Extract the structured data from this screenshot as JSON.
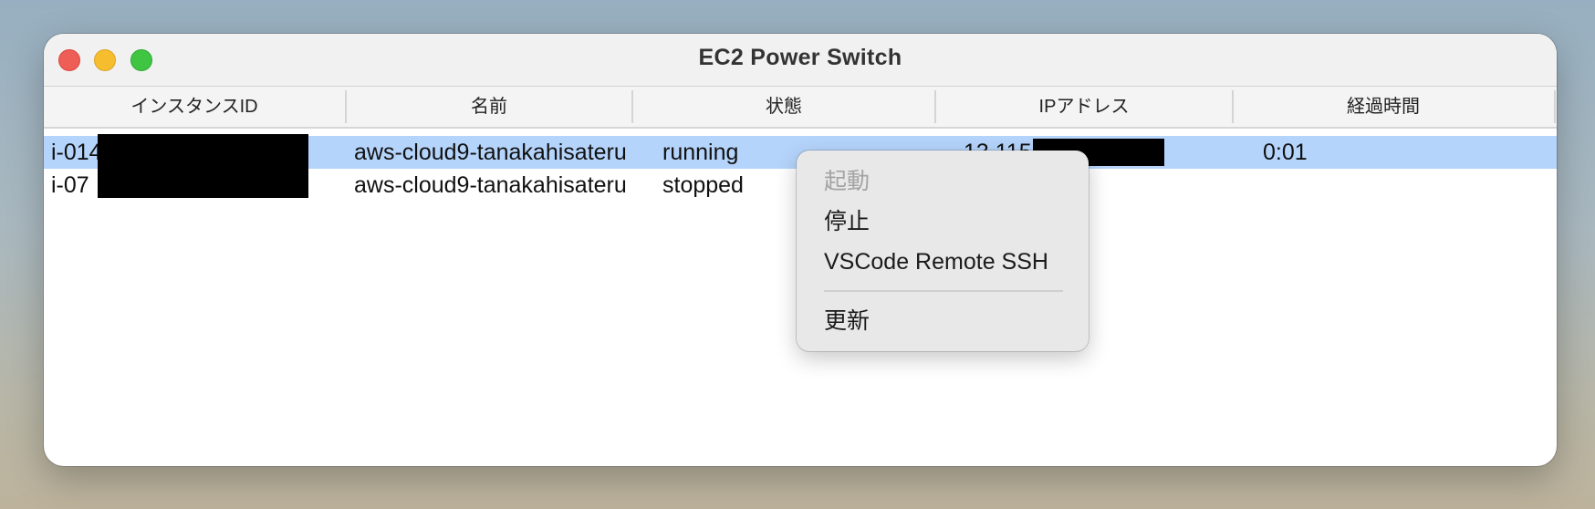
{
  "window": {
    "title": "EC2 Power Switch"
  },
  "table": {
    "columns": [
      "インスタンスID",
      "名前",
      "状態",
      "IPアドレス",
      "経過時間"
    ],
    "rows": [
      {
        "instance_id": "i-014",
        "name": "aws-cloud9-tanakahisateru",
        "state": "running",
        "ip": "13.115",
        "elapsed": "0:01",
        "selected": true
      },
      {
        "instance_id": "i-07",
        "name": "aws-cloud9-tanakahisateru",
        "state": "stopped",
        "ip": "",
        "elapsed": "",
        "selected": false
      }
    ]
  },
  "context_menu": {
    "items": [
      {
        "label": "起動",
        "enabled": false
      },
      {
        "label": "停止",
        "enabled": true
      },
      {
        "label": "VSCode Remote SSH",
        "enabled": true
      },
      {
        "label": "更新",
        "enabled": true
      }
    ]
  },
  "colors": {
    "selection": "#b5d4fb",
    "close": "#ee5e56",
    "minimize": "#f6be2e",
    "zoom": "#3fc542"
  }
}
